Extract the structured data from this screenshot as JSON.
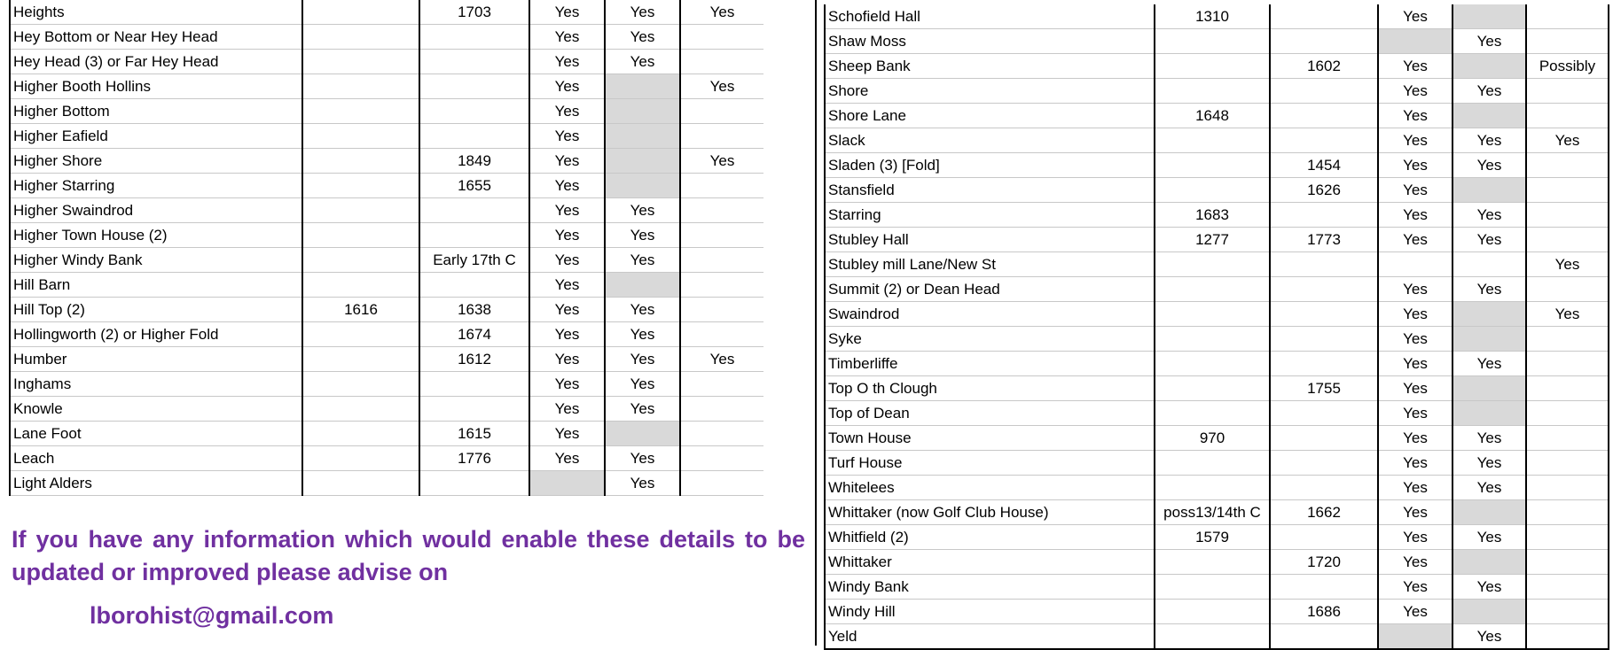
{
  "left_table": {
    "rows": [
      {
        "name": "Heights",
        "c1": "",
        "c2": "1703",
        "c3": "Yes",
        "c4": "Yes",
        "c5": "Yes",
        "grey": []
      },
      {
        "name": "Hey Bottom or Near Hey Head",
        "c1": "",
        "c2": "",
        "c3": "Yes",
        "c4": "Yes",
        "c5": "",
        "grey": []
      },
      {
        "name": "Hey Head (3) or Far Hey Head",
        "c1": "",
        "c2": "",
        "c3": "Yes",
        "c4": "Yes",
        "c5": "",
        "grey": []
      },
      {
        "name": "Higher Booth Hollins",
        "c1": "",
        "c2": "",
        "c3": "Yes",
        "c4": "",
        "c5": "Yes",
        "grey": [
          "c4"
        ]
      },
      {
        "name": "Higher Bottom",
        "c1": "",
        "c2": "",
        "c3": "Yes",
        "c4": "",
        "c5": "",
        "grey": [
          "c4"
        ]
      },
      {
        "name": "Higher Eafield",
        "c1": "",
        "c2": "",
        "c3": "Yes",
        "c4": "",
        "c5": "",
        "grey": [
          "c4"
        ]
      },
      {
        "name": "Higher Shore",
        "c1": "",
        "c2": "1849",
        "c3": "Yes",
        "c4": "",
        "c5": "Yes",
        "grey": [
          "c4"
        ]
      },
      {
        "name": "Higher Starring",
        "c1": "",
        "c2": "1655",
        "c3": "Yes",
        "c4": "",
        "c5": "",
        "grey": [
          "c4"
        ]
      },
      {
        "name": "Higher Swaindrod",
        "c1": "",
        "c2": "",
        "c3": "Yes",
        "c4": "Yes",
        "c5": "",
        "grey": []
      },
      {
        "name": "Higher Town House (2)",
        "c1": "",
        "c2": "",
        "c3": "Yes",
        "c4": "Yes",
        "c5": "",
        "grey": []
      },
      {
        "name": "Higher Windy Bank",
        "c1": "",
        "c2": "Early 17th C",
        "c3": "Yes",
        "c4": "Yes",
        "c5": "",
        "grey": []
      },
      {
        "name": "Hill Barn",
        "c1": "",
        "c2": "",
        "c3": "Yes",
        "c4": "",
        "c5": "",
        "grey": [
          "c4"
        ]
      },
      {
        "name": "Hill Top (2)",
        "c1": "1616",
        "c2": "1638",
        "c3": "Yes",
        "c4": "Yes",
        "c5": "",
        "grey": []
      },
      {
        "name": "Hollingworth (2) or Higher Fold",
        "c1": "",
        "c2": "1674",
        "c3": "Yes",
        "c4": "Yes",
        "c5": "",
        "grey": []
      },
      {
        "name": "Humber",
        "c1": "",
        "c2": "1612",
        "c3": "Yes",
        "c4": "Yes",
        "c5": "Yes",
        "grey": []
      },
      {
        "name": "Inghams",
        "c1": "",
        "c2": "",
        "c3": "Yes",
        "c4": "Yes",
        "c5": "",
        "grey": []
      },
      {
        "name": "Knowle",
        "c1": "",
        "c2": "",
        "c3": "Yes",
        "c4": "Yes",
        "c5": "",
        "grey": []
      },
      {
        "name": "Lane Foot",
        "c1": "",
        "c2": "1615",
        "c3": "Yes",
        "c4": "",
        "c5": "",
        "grey": [
          "c4"
        ]
      },
      {
        "name": "Leach",
        "c1": "",
        "c2": "1776",
        "c3": "Yes",
        "c4": "Yes",
        "c5": "",
        "grey": []
      },
      {
        "name": "Light Alders",
        "c1": "",
        "c2": "",
        "c3": "",
        "c4": "Yes",
        "c5": "",
        "grey": [
          "c3"
        ]
      }
    ]
  },
  "right_table": {
    "rows": [
      {
        "name": "Schofield Hall",
        "c1": "1310",
        "c2": "",
        "c3": "Yes",
        "c4": "",
        "c5": "",
        "grey": [
          "c4"
        ]
      },
      {
        "name": "Shaw Moss",
        "c1": "",
        "c2": "",
        "c3": "",
        "c4": "Yes",
        "c5": "",
        "grey": [
          "c3"
        ]
      },
      {
        "name": "Sheep Bank",
        "c1": "",
        "c2": "1602",
        "c3": "Yes",
        "c4": "",
        "c5": "Possibly",
        "grey": [
          "c4"
        ]
      },
      {
        "name": "Shore",
        "c1": "",
        "c2": "",
        "c3": "Yes",
        "c4": "Yes",
        "c5": "",
        "grey": []
      },
      {
        "name": "Shore Lane",
        "c1": "1648",
        "c2": "",
        "c3": "Yes",
        "c4": "",
        "c5": "",
        "grey": [
          "c4"
        ]
      },
      {
        "name": "Slack",
        "c1": "",
        "c2": "",
        "c3": "Yes",
        "c4": "Yes",
        "c5": "Yes",
        "grey": []
      },
      {
        "name": "Sladen (3) [Fold]",
        "c1": "",
        "c2": "1454",
        "c3": "Yes",
        "c4": "Yes",
        "c5": "",
        "grey": []
      },
      {
        "name": "Stansfield",
        "c1": "",
        "c2": "1626",
        "c3": "Yes",
        "c4": "",
        "c5": "",
        "grey": [
          "c4"
        ]
      },
      {
        "name": "Starring",
        "c1": "1683",
        "c2": "",
        "c3": "Yes",
        "c4": "Yes",
        "c5": "",
        "grey": []
      },
      {
        "name": "Stubley Hall",
        "c1": "1277",
        "c2": "1773",
        "c3": "Yes",
        "c4": "Yes",
        "c5": "",
        "grey": []
      },
      {
        "name": "Stubley mill Lane/New St",
        "c1": "",
        "c2": "",
        "c3": "",
        "c4": "",
        "c5": "Yes",
        "grey": []
      },
      {
        "name": "Summit (2) or Dean Head",
        "c1": "",
        "c2": "",
        "c3": "Yes",
        "c4": "Yes",
        "c5": "",
        "grey": []
      },
      {
        "name": "Swaindrod",
        "c1": "",
        "c2": "",
        "c3": "Yes",
        "c4": "",
        "c5": "Yes",
        "grey": [
          "c4"
        ]
      },
      {
        "name": "Syke",
        "c1": "",
        "c2": "",
        "c3": "Yes",
        "c4": "",
        "c5": "",
        "grey": [
          "c4"
        ]
      },
      {
        "name": "Timberliffe",
        "c1": "",
        "c2": "",
        "c3": "Yes",
        "c4": "Yes",
        "c5": "",
        "grey": []
      },
      {
        "name": "Top O th Clough",
        "c1": "",
        "c2": "1755",
        "c3": "Yes",
        "c4": "",
        "c5": "",
        "grey": [
          "c4"
        ]
      },
      {
        "name": "Top of Dean",
        "c1": "",
        "c2": "",
        "c3": "Yes",
        "c4": "",
        "c5": "",
        "grey": [
          "c4"
        ]
      },
      {
        "name": "Town House",
        "c1": "970",
        "c2": "",
        "c3": "Yes",
        "c4": "Yes",
        "c5": "",
        "grey": []
      },
      {
        "name": "Turf House",
        "c1": "",
        "c2": "",
        "c3": "Yes",
        "c4": "Yes",
        "c5": "",
        "grey": []
      },
      {
        "name": "Whitelees",
        "c1": "",
        "c2": "",
        "c3": "Yes",
        "c4": "Yes",
        "c5": "",
        "grey": []
      },
      {
        "name": "Whittaker (now Golf Club House)",
        "c1": "poss13/14th C",
        "c2": "1662",
        "c3": "Yes",
        "c4": "",
        "c5": "",
        "grey": [
          "c4"
        ]
      },
      {
        "name": "Whitfield (2)",
        "c1": "1579",
        "c2": "",
        "c3": "Yes",
        "c4": "Yes",
        "c5": "",
        "grey": []
      },
      {
        "name": "Whittaker",
        "c1": "",
        "c2": "1720",
        "c3": "Yes",
        "c4": "",
        "c5": "",
        "grey": [
          "c4"
        ]
      },
      {
        "name": "Windy Bank",
        "c1": "",
        "c2": "",
        "c3": "Yes",
        "c4": "Yes",
        "c5": "",
        "grey": []
      },
      {
        "name": "Windy Hill",
        "c1": "",
        "c2": "1686",
        "c3": "Yes",
        "c4": "",
        "c5": "",
        "grey": [
          "c4"
        ]
      },
      {
        "name": "Yeld",
        "c1": "",
        "c2": "",
        "c3": "",
        "c4": "Yes",
        "c5": "",
        "grey": [
          "c3"
        ]
      }
    ]
  },
  "notice": {
    "text": "If you have any information which would enable these details to be updated or improved please advise on",
    "email": "lborohist@gmail.com"
  }
}
